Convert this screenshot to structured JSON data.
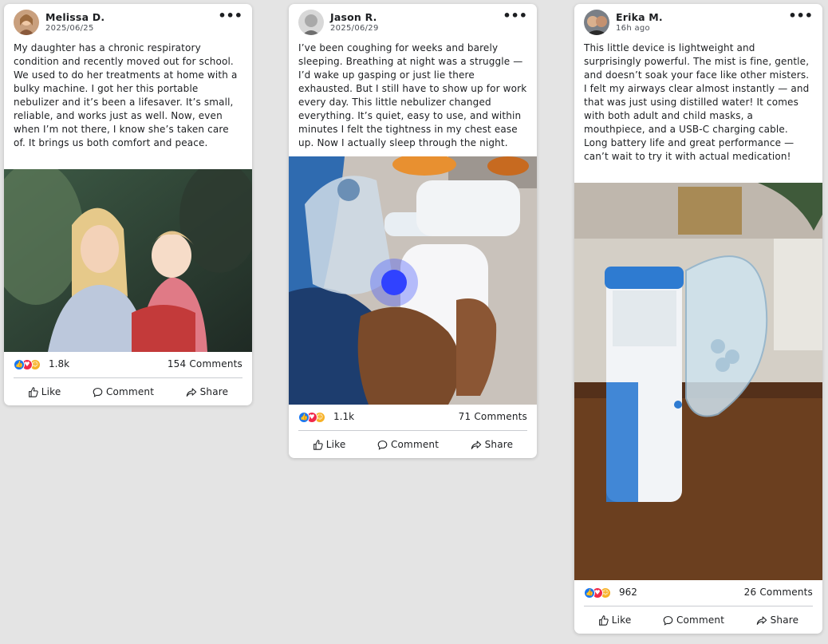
{
  "posts": [
    {
      "author": "Melissa D.",
      "date": "2025/06/25",
      "more_label": "•••",
      "text": "My daughter has a chronic respiratory condition and recently moved out for school. We used to do her treatments at home with a bulky machine. I got her this portable nebulizer and it’s been a lifesaver. It’s small, reliable, and works just as well. Now, even when I’m not there, I know she’s taken care of. It brings us both comfort and peace.",
      "reactions": "1.8k",
      "comments": "154 Comments"
    },
    {
      "author": "Jason R.",
      "date": "2025/06/29",
      "more_label": "•••",
      "text": "I’ve been coughing for weeks and barely sleeping. Breathing at night was a struggle — I’d wake up gasping or just lie there exhausted. But I still have to show up for work every day. This little nebulizer changed everything. It’s quiet, easy to use, and within minutes I felt the tightness in my chest ease up. Now I actually sleep through the night.",
      "reactions": "1.1k",
      "comments": "71 Comments"
    },
    {
      "author": "Erika M.",
      "date": "16h ago",
      "more_label": "•••",
      "text": "This little device is lightweight and surprisingly powerful. The mist is fine, gentle, and doesn’t soak your face like other misters. I felt my airways clear almost instantly — and that was just using distilled water! It comes with both adult and child masks, a mouthpiece, and a USB-C charging cable. Long battery life and great performance — can’t wait to try it with actual medication!",
      "reactions": "962",
      "comments": "26 Comments"
    }
  ],
  "actions": {
    "like": "Like",
    "comment": "Comment",
    "share": "Share"
  },
  "icons": {
    "reaction_like": "like-reaction-icon",
    "reaction_love": "love-reaction-icon",
    "reaction_care": "care-reaction-icon"
  },
  "colors": {
    "like_blue": "#1877f2",
    "love_red": "#f02849",
    "care_yellow": "#f7b125"
  }
}
